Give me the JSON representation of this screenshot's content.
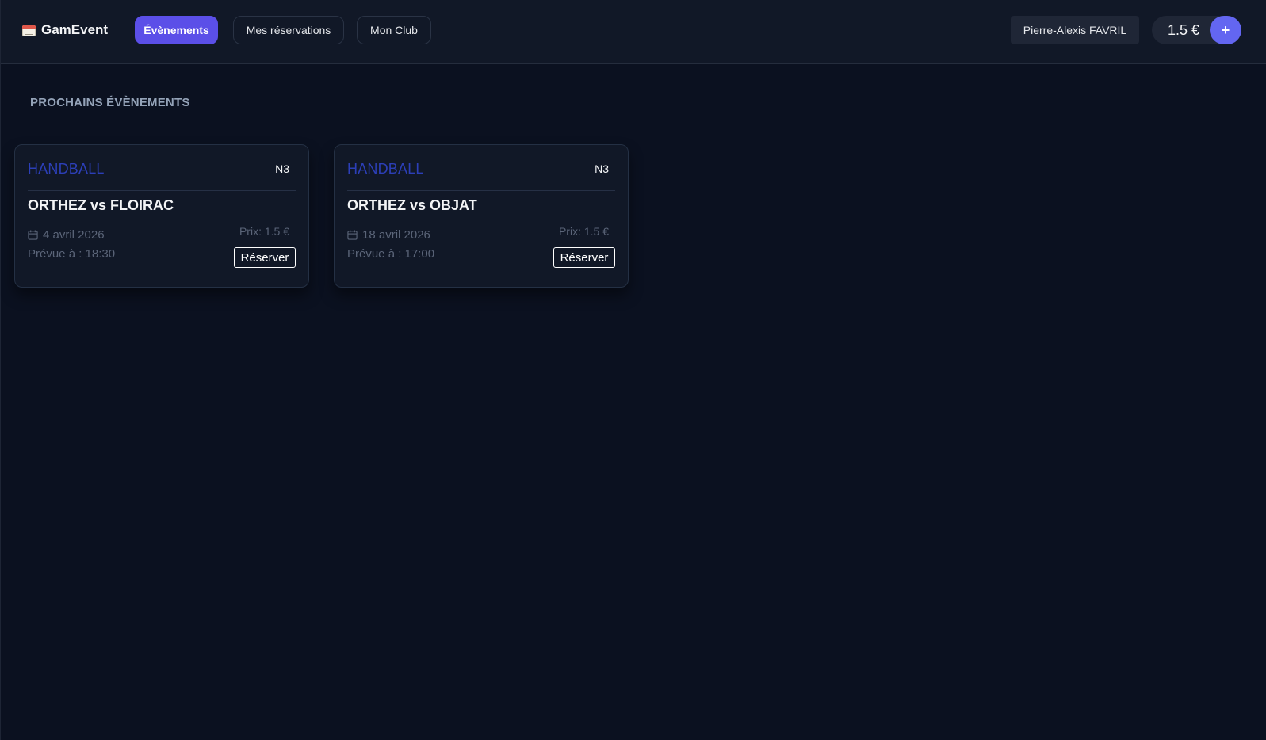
{
  "brand": {
    "name": "GamEvent",
    "icon": "calendar-icon"
  },
  "nav": {
    "events": "Évènements",
    "reservations": "Mes réservations",
    "club": "Mon Club"
  },
  "user": {
    "name": "Pierre-Alexis FAVRIL"
  },
  "wallet": {
    "balance": "1.5 €",
    "add_label": "+"
  },
  "colors": {
    "accent": "#5b4fe8",
    "sport_label": "#2c3fb8",
    "background": "#0b1120"
  },
  "section": {
    "title": "PROCHAINS ÉVÈNEMENTS"
  },
  "events": [
    {
      "sport": "HANDBALL",
      "level": "N3",
      "match": "ORTHEZ vs FLOIRAC",
      "date": "4 avril 2026",
      "time": "Prévue à : 18:30",
      "price": "Prix: 1.5 €",
      "reserve_label": "Réserver"
    },
    {
      "sport": "HANDBALL",
      "level": "N3",
      "match": "ORTHEZ vs OBJAT",
      "date": "18 avril 2026",
      "time": "Prévue à : 17:00",
      "price": "Prix: 1.5 €",
      "reserve_label": "Réserver"
    }
  ]
}
